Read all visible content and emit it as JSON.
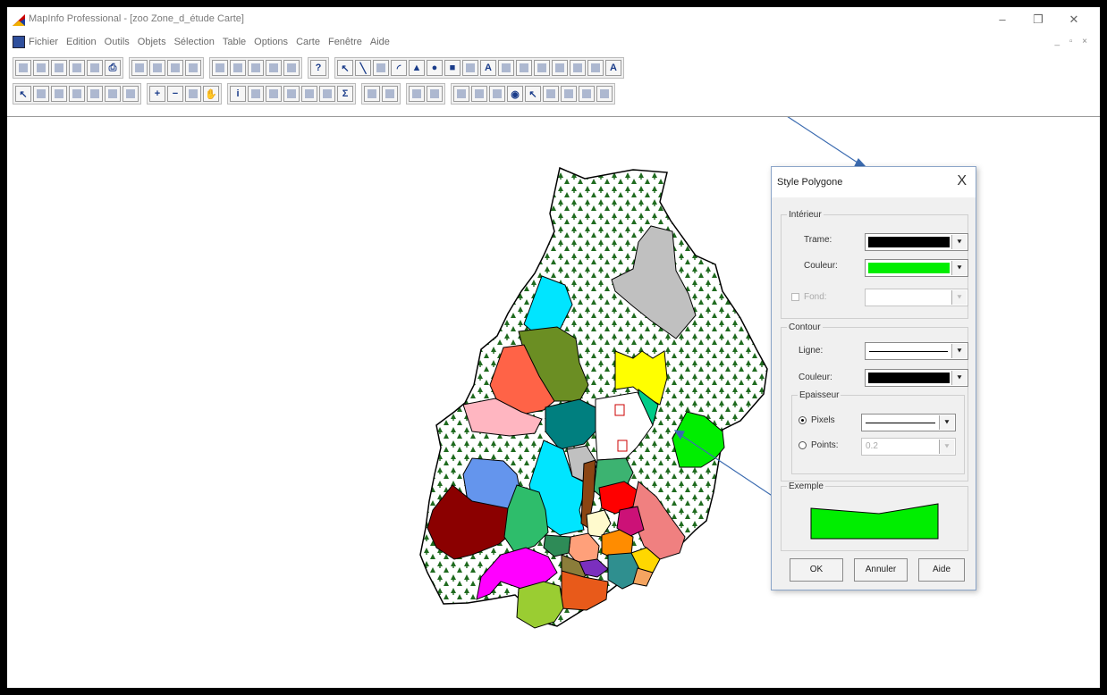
{
  "window": {
    "title": "MapInfo Professional - [zoo Zone_d_étude Carte]",
    "controls": {
      "minimize": "–",
      "maximize": "❐",
      "close": "✕"
    },
    "mdi_controls": "_ ▫ ×"
  },
  "menu": [
    "Fichier",
    "Edition",
    "Outils",
    "Objets",
    "Sélection",
    "Table",
    "Options",
    "Carte",
    "Fenêtre",
    "Aide"
  ],
  "toolbars": {
    "row1": [
      [
        "new-icon",
        "open-icon",
        "save-icon",
        "save-workspace-icon",
        "close-icon",
        "print-icon"
      ],
      [
        "cut-icon",
        "copy-icon",
        "paste-icon",
        "undo-icon"
      ],
      [
        "new-browser-icon",
        "new-mapper-icon",
        "new-grapher-icon",
        "new-layout-icon",
        "new-redistrict-icon"
      ],
      [
        "help-icon"
      ],
      [
        "select-icon",
        "line-icon",
        "polyline-icon",
        "arc-icon",
        "polygon-icon",
        "ellipse-icon",
        "rectangle-icon",
        "rounded-rectangle-icon",
        "text-icon",
        "frame-icon",
        "reshape-icon",
        "add-node-icon",
        "symbol-style-icon",
        "line-style-icon",
        "region-style-icon",
        "text-style-icon"
      ]
    ],
    "row2": [
      [
        "select-icon",
        "marquee-select-icon",
        "radius-select-icon",
        "polygon-select-icon",
        "boundary-select-icon",
        "unselect-all-icon",
        "graph-select-icon"
      ],
      [
        "zoom-in-icon",
        "zoom-out-icon",
        "change-view-icon",
        "grabber-icon"
      ],
      [
        "info-icon",
        "ruler-icon",
        "label-icon",
        "drag-window-icon",
        "layer-control-icon",
        "legend-icon",
        "statistics-icon"
      ],
      [
        "hotlink-icon",
        "clip-region-icon"
      ],
      [
        "show-legend-icon",
        "redistrict-icon"
      ],
      [
        "scale-bar-icon",
        "north-arrow-icon",
        "frame-tool-icon",
        "globe-icon",
        "select-icon",
        "polyline-icon",
        "region-icon",
        "point-icon",
        "digitize-icon"
      ]
    ]
  },
  "dialog": {
    "title": "Style Polygone",
    "close": "X",
    "interior": {
      "legend": "Intérieur",
      "trame_label": "Trame:",
      "couleur_label": "Couleur:",
      "fond_label": "Fond:",
      "trame_color": "#000000",
      "couleur_color": "#00ee00"
    },
    "contour": {
      "legend": "Contour",
      "ligne_label": "Ligne:",
      "couleur_label": "Couleur:",
      "couleur_color": "#000000",
      "epaisseur": {
        "legend": "Epaisseur",
        "pixels_label": "Pixels",
        "points_label": "Points:",
        "points_value": "0.2"
      }
    },
    "exemple": {
      "legend": "Exemple",
      "fill": "#00ee00"
    },
    "buttons": {
      "ok": "OK",
      "cancel": "Annuler",
      "help": "Aide"
    }
  },
  "map": {
    "outline_color": "#000000",
    "pattern_tree_color": "#1f6b1f",
    "region_colors": [
      "#00e5ff",
      "#6b8e23",
      "#ff6347",
      "#ffb6c1",
      "#007f7f",
      "#ffff00",
      "#c0c0c0",
      "#00ff7f",
      "#2e8b57",
      "#8b0000",
      "#6495ed",
      "#ff00ff",
      "#32cd32",
      "#ff1493",
      "#ff0000",
      "#f08080",
      "#ff8c00",
      "#8b4513",
      "#00ff00",
      "#d2691e",
      "#ffa07a",
      "#9acd32",
      "#3cb371",
      "#ffd700"
    ],
    "arrow_color": "#3b6bb0"
  }
}
